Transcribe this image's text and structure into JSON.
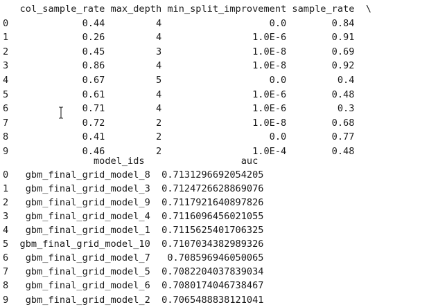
{
  "table1": {
    "header": "   col_sample_rate max_depth min_split_improvement sample_rate  \\",
    "rows": [
      "0             0.44         4                   0.0        0.84   ",
      "1             0.26         4                1.0E-6        0.91   ",
      "2             0.45         3                1.0E-8        0.69   ",
      "3             0.86         4                1.0E-8        0.92   ",
      "4             0.67         5                   0.0         0.4   ",
      "5             0.61         4                1.0E-6        0.48   ",
      "6             0.71         4                1.0E-6         0.3   ",
      "7             0.72         2                1.0E-8        0.68   ",
      "8             0.41         2                   0.0        0.77   ",
      "9             0.46         2                1.0E-4        0.48   "
    ]
  },
  "table2": {
    "header": "                model_ids                 auc",
    "rows": [
      "0   gbm_final_grid_model_8  0.7131296692054205",
      "1   gbm_final_grid_model_3  0.7124726628869076",
      "2   gbm_final_grid_model_9  0.7117921640897826",
      "3   gbm_final_grid_model_4  0.7116096456021055",
      "4   gbm_final_grid_model_1  0.7115625401706325",
      "5  gbm_final_grid_model_10  0.7107034382989326",
      "6   gbm_final_grid_model_7   0.708596946050065",
      "7   gbm_final_grid_model_5  0.7082204037839034",
      "8   gbm_final_grid_model_6  0.7080174046738467",
      "9   gbm_final_grid_model_2  0.7065488838121041"
    ]
  },
  "cursor": {
    "icon": "text-cursor-icon"
  }
}
